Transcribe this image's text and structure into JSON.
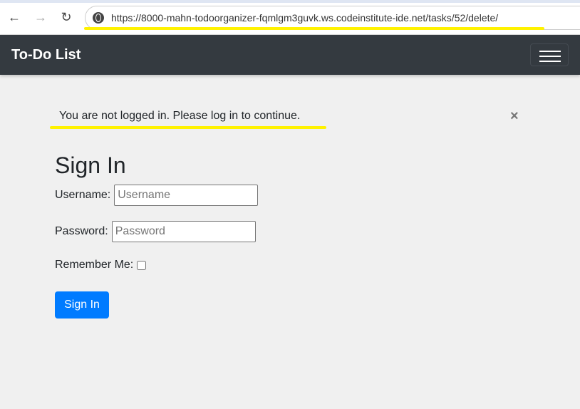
{
  "browser": {
    "url": "https://8000-mahn-todoorganizer-fqmlgm3guvk.ws.codeinstitute-ide.net/tasks/52/delete/",
    "back_icon": "←",
    "forward_icon": "→",
    "reload_icon": "↻"
  },
  "navbar": {
    "brand": "To-Do List"
  },
  "alert": {
    "message": "You are not logged in. Please log in to continue.",
    "close": "×"
  },
  "form": {
    "title": "Sign In",
    "username_label": "Username:",
    "username_placeholder": "Username",
    "password_label": "Password:",
    "password_placeholder": "Password",
    "remember_label": "Remember Me:",
    "submit": "Sign In"
  }
}
